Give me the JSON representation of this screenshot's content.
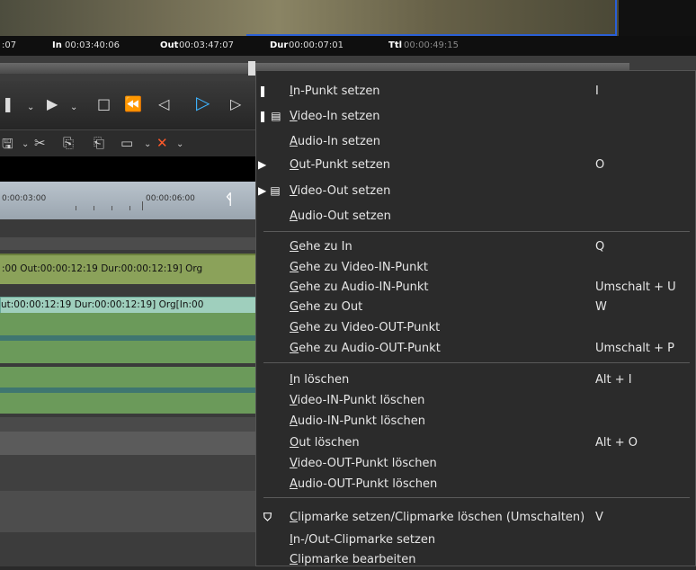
{
  "timecodes": {
    "left_fragment": ":07",
    "in_label": "In",
    "in_value": "00:03:40:06",
    "out_label": "Out",
    "out_value": "00:03:47:07",
    "dur_label": "Dur",
    "dur_value": "00:00:07:01",
    "ttl_label": "Ttl",
    "ttl_value": "00:00:49:15"
  },
  "ruler": {
    "tc1": "0:00:03:00",
    "tc2": "00:00:06:00"
  },
  "clips": {
    "clip1": ":00 Out:00:00:12:19 Dur:00:00:12:19]  Org",
    "clip2": "ut:00:00:12:19 Dur:00:00:12:19]  Org[In:00"
  },
  "menu": {
    "items": [
      {
        "icon": "❚",
        "label": "In-Punkt setzen",
        "shortcut": "I"
      },
      {
        "icon": "❚ ▤",
        "label": "Video-In setzen",
        "shortcut": ""
      },
      {
        "icon": "",
        "label": "Audio-In setzen",
        "shortcut": ""
      },
      {
        "icon": "▶",
        "label": "Out-Punkt setzen",
        "shortcut": "O"
      },
      {
        "icon": "▶ ▤",
        "label": "Video-Out setzen",
        "shortcut": ""
      },
      {
        "icon": "",
        "label": "Audio-Out setzen",
        "shortcut": ""
      },
      {
        "icon": "",
        "label": "Gehe zu In",
        "shortcut": "Q"
      },
      {
        "icon": "",
        "label": "Gehe zu Video-IN-Punkt",
        "shortcut": ""
      },
      {
        "icon": "",
        "label": "Gehe zu Audio-IN-Punkt",
        "shortcut": "Umschalt + U"
      },
      {
        "icon": "",
        "label": "Gehe zu Out",
        "shortcut": "W"
      },
      {
        "icon": "",
        "label": "Gehe zu Video-OUT-Punkt",
        "shortcut": ""
      },
      {
        "icon": "",
        "label": "Gehe zu Audio-OUT-Punkt",
        "shortcut": "Umschalt + P"
      },
      {
        "icon": "",
        "label": "In löschen",
        "shortcut": "Alt + I"
      },
      {
        "icon": "",
        "label": "Video-IN-Punkt löschen",
        "shortcut": ""
      },
      {
        "icon": "",
        "label": "Audio-IN-Punkt löschen",
        "shortcut": ""
      },
      {
        "icon": "",
        "label": "Out löschen",
        "shortcut": "Alt + O"
      },
      {
        "icon": "",
        "label": "Video-OUT-Punkt löschen",
        "shortcut": ""
      },
      {
        "icon": "",
        "label": "Audio-OUT-Punkt löschen",
        "shortcut": ""
      },
      {
        "icon": "⛉",
        "label": "Clipmarke setzen/Clipmarke löschen (Umschalten)",
        "shortcut": "V"
      },
      {
        "icon": "",
        "label": "In-/Out-Clipmarke setzen",
        "shortcut": ""
      },
      {
        "icon": "",
        "label": "Clipmarke bearbeiten",
        "shortcut": ""
      }
    ]
  }
}
